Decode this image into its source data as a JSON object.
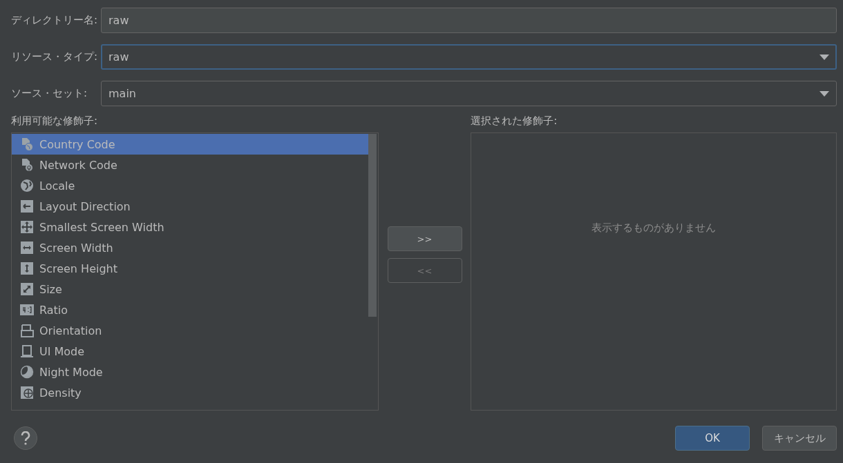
{
  "fields": [
    {
      "label": "ディレクトリー名:",
      "kind": "text",
      "value": "raw",
      "focused": false
    },
    {
      "label": "リソース・タイプ:",
      "kind": "dropdown",
      "value": "raw",
      "focused": true
    },
    {
      "label": "ソース・セット:",
      "kind": "dropdown",
      "value": "main",
      "focused": false
    }
  ],
  "available": {
    "title": "利用可能な修飾子:",
    "items": [
      {
        "label": "Country Code",
        "selected": true
      },
      {
        "label": "Network Code",
        "selected": false
      },
      {
        "label": "Locale",
        "selected": false
      },
      {
        "label": "Layout Direction",
        "selected": false
      },
      {
        "label": "Smallest Screen Width",
        "selected": false
      },
      {
        "label": "Screen Width",
        "selected": false
      },
      {
        "label": "Screen Height",
        "selected": false
      },
      {
        "label": "Size",
        "selected": false
      },
      {
        "label": "Ratio",
        "selected": false
      },
      {
        "label": "Orientation",
        "selected": false
      },
      {
        "label": "UI Mode",
        "selected": false
      },
      {
        "label": "Night Mode",
        "selected": false
      },
      {
        "label": "Density",
        "selected": false
      }
    ]
  },
  "move_buttons": [
    {
      "label": ">>",
      "disabled": false
    },
    {
      "label": "<<",
      "disabled": true
    }
  ],
  "chosen": {
    "title": "選択された修飾子:",
    "empty_text": "表示するものがありません"
  },
  "footer": {
    "buttons": [
      {
        "label": "OK",
        "kind": "primary"
      },
      {
        "label": "キャンセル",
        "kind": "secondary"
      }
    ]
  }
}
